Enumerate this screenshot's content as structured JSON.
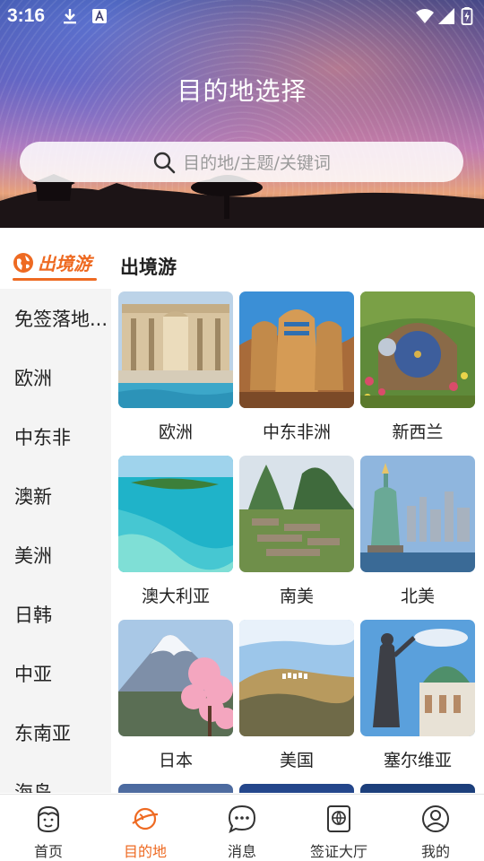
{
  "status_bar": {
    "time": "3:16"
  },
  "header": {
    "title": "目的地选择",
    "search_placeholder": "目的地/主题/关键词"
  },
  "sidebar": {
    "active": {
      "label": "出境游"
    },
    "items": [
      {
        "label": "免签落地..."
      },
      {
        "label": "欧洲"
      },
      {
        "label": "中东非"
      },
      {
        "label": "澳新"
      },
      {
        "label": "美洲"
      },
      {
        "label": "日韩"
      },
      {
        "label": "中亚"
      },
      {
        "label": "东南亚"
      },
      {
        "label": "海岛"
      }
    ]
  },
  "main": {
    "section_title": "出境游",
    "cards": [
      {
        "label": "欧洲",
        "image": "trevi-fountain"
      },
      {
        "label": "中东非洲",
        "image": "egyptian-statues"
      },
      {
        "label": "新西兰",
        "image": "hobbit-door"
      },
      {
        "label": "澳大利亚",
        "image": "island-reef"
      },
      {
        "label": "南美",
        "image": "machu-picchu"
      },
      {
        "label": "北美",
        "image": "statue-of-liberty"
      },
      {
        "label": "日本",
        "image": "mount-fuji"
      },
      {
        "label": "美国",
        "image": "hollywood-hills"
      },
      {
        "label": "塞尔维亚",
        "image": "saint-sava-statue"
      }
    ]
  },
  "bottom_nav": {
    "items": [
      {
        "label": "首页",
        "icon": "home-face-icon"
      },
      {
        "label": "目的地",
        "icon": "planet-icon"
      },
      {
        "label": "消息",
        "icon": "chat-bubble-icon"
      },
      {
        "label": "签证大厅",
        "icon": "passport-icon"
      },
      {
        "label": "我的",
        "icon": "profile-icon"
      }
    ]
  },
  "colors": {
    "accent": "#ee6a22",
    "sidebar_bg": "#f4f4f4"
  }
}
